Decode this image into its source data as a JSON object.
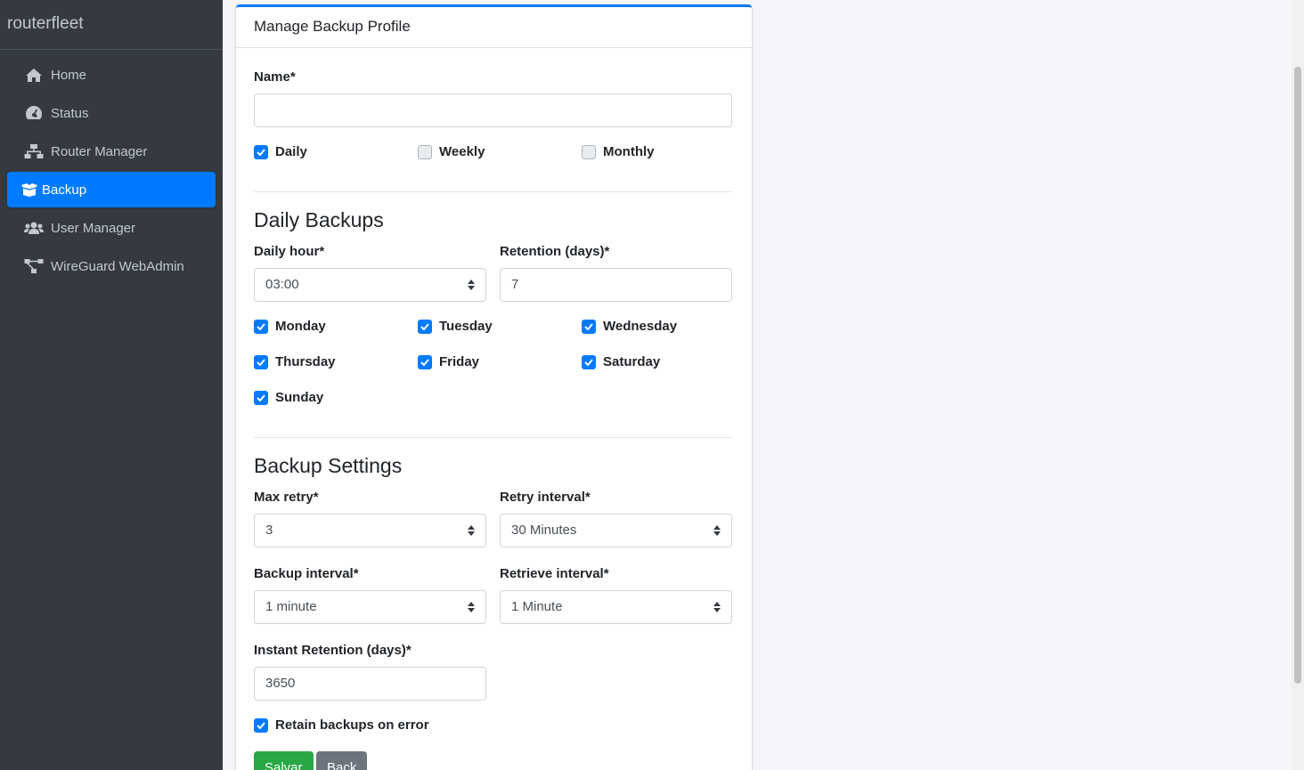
{
  "sidebar": {
    "brand": "routerfleet",
    "items": [
      {
        "label": "Home",
        "icon": "home-icon"
      },
      {
        "label": "Status",
        "icon": "tachometer-icon"
      },
      {
        "label": "Router Manager",
        "icon": "network-icon"
      },
      {
        "label": "Backup",
        "icon": "box-open-icon",
        "active": true
      },
      {
        "label": "User Manager",
        "icon": "users-icon"
      },
      {
        "label": "WireGuard WebAdmin",
        "icon": "project-diagram-icon"
      }
    ]
  },
  "card": {
    "title": "Manage Backup Profile",
    "name_label": "Name*",
    "name_value": "",
    "frequency": {
      "daily": {
        "label": "Daily",
        "checked": true
      },
      "weekly": {
        "label": "Weekly",
        "checked": false
      },
      "monthly": {
        "label": "Monthly",
        "checked": false
      }
    },
    "daily_section": {
      "title": "Daily Backups",
      "hour_label": "Daily hour*",
      "hour_value": "03:00",
      "retention_label": "Retention (days)*",
      "retention_value": "7",
      "days": [
        {
          "label": "Monday",
          "checked": true
        },
        {
          "label": "Tuesday",
          "checked": true
        },
        {
          "label": "Wednesday",
          "checked": true
        },
        {
          "label": "Thursday",
          "checked": true
        },
        {
          "label": "Friday",
          "checked": true
        },
        {
          "label": "Saturday",
          "checked": true
        },
        {
          "label": "Sunday",
          "checked": true
        }
      ]
    },
    "settings_section": {
      "title": "Backup Settings",
      "max_retry_label": "Max retry*",
      "max_retry_value": "3",
      "retry_interval_label": "Retry interval*",
      "retry_interval_value": "30 Minutes",
      "backup_interval_label": "Backup interval*",
      "backup_interval_value": "1 minute",
      "retrieve_interval_label": "Retrieve interval*",
      "retrieve_interval_value": "1 Minute",
      "instant_retention_label": "Instant Retention (days)*",
      "instant_retention_value": "3650",
      "retain_on_error_label": "Retain backups on error",
      "retain_on_error_checked": true
    },
    "buttons": {
      "save": "Salvar",
      "back": "Back"
    }
  },
  "colors": {
    "primary": "#007bff",
    "sidebar_bg": "#343a40",
    "success": "#28a745",
    "secondary": "#6c757d"
  }
}
